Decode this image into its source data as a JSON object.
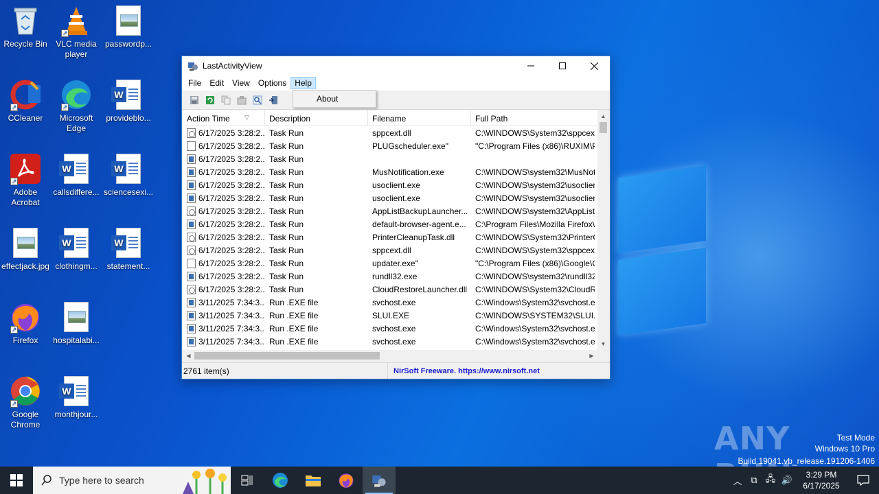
{
  "desktop": {
    "icons": [
      {
        "label": "Recycle Bin"
      },
      {
        "label": "VLC media player"
      },
      {
        "label": "passwordp..."
      },
      {
        "label": "CCleaner"
      },
      {
        "label": "Microsoft Edge"
      },
      {
        "label": "provideblo..."
      },
      {
        "label": "Adobe Acrobat"
      },
      {
        "label": "callsdiffere..."
      },
      {
        "label": "sciencesexi..."
      },
      {
        "label": "effectjack.jpg"
      },
      {
        "label": "clothingm..."
      },
      {
        "label": "statement..."
      },
      {
        "label": "Firefox"
      },
      {
        "label": "hospitalabi..."
      },
      {
        "label": "Google Chrome"
      },
      {
        "label": "monthjour..."
      }
    ]
  },
  "window": {
    "title": "LastActivityView",
    "menu": [
      "File",
      "Edit",
      "View",
      "Options",
      "Help"
    ],
    "help_dropdown": {
      "about": "About"
    },
    "columns": [
      "Action Time",
      "Description",
      "Filename",
      "Full Path"
    ],
    "rows": [
      {
        "icon": "dll",
        "time": "6/17/2025 3:28:2...",
        "desc": "Task Run",
        "file": "sppcext.dll",
        "path": "C:\\WINDOWS\\System32\\sppcext.c"
      },
      {
        "icon": "blank",
        "time": "6/17/2025 3:28:2...",
        "desc": "Task Run",
        "file": "PLUGscheduler.exe\"",
        "path": "\"C:\\Program Files (x86)\\RUXIM\\PL"
      },
      {
        "icon": "exe",
        "time": "6/17/2025 3:28:2...",
        "desc": "Task Run",
        "file": "",
        "path": ""
      },
      {
        "icon": "exe",
        "time": "6/17/2025 3:28:2...",
        "desc": "Task Run",
        "file": "MusNotification.exe",
        "path": "C:\\WINDOWS\\system32\\MusNoti"
      },
      {
        "icon": "exe",
        "time": "6/17/2025 3:28:2...",
        "desc": "Task Run",
        "file": "usoclient.exe",
        "path": "C:\\WINDOWS\\system32\\usoclient"
      },
      {
        "icon": "exe",
        "time": "6/17/2025 3:28:2...",
        "desc": "Task Run",
        "file": "usoclient.exe",
        "path": "C:\\WINDOWS\\system32\\usoclient"
      },
      {
        "icon": "dll",
        "time": "6/17/2025 3:28:2...",
        "desc": "Task Run",
        "file": "AppListBackupLauncher...",
        "path": "C:\\WINDOWS\\system32\\AppListB"
      },
      {
        "icon": "exe",
        "time": "6/17/2025 3:28:2...",
        "desc": "Task Run",
        "file": "default-browser-agent.e...",
        "path": "C:\\Program Files\\Mozilla Firefox\\c"
      },
      {
        "icon": "dll",
        "time": "6/17/2025 3:28:2...",
        "desc": "Task Run",
        "file": "PrinterCleanupTask.dll",
        "path": "C:\\WINDOWS\\System32\\PrinterCl"
      },
      {
        "icon": "dll",
        "time": "6/17/2025 3:28:2...",
        "desc": "Task Run",
        "file": "sppcext.dll",
        "path": "C:\\WINDOWS\\System32\\sppcext.c"
      },
      {
        "icon": "blank",
        "time": "6/17/2025 3:28:2...",
        "desc": "Task Run",
        "file": "updater.exe\"",
        "path": "\"C:\\Program Files (x86)\\Google\\G"
      },
      {
        "icon": "exe",
        "time": "6/17/2025 3:28:2...",
        "desc": "Task Run",
        "file": "rundll32.exe",
        "path": "C:\\WINDOWS\\system32\\rundll32."
      },
      {
        "icon": "dll",
        "time": "6/17/2025 3:28:2...",
        "desc": "Task Run",
        "file": "CloudRestoreLauncher.dll",
        "path": "C:\\WINDOWS\\System32\\CloudRe"
      },
      {
        "icon": "exe",
        "time": "3/11/2025 7:34:3...",
        "desc": "Run .EXE file",
        "file": "svchost.exe",
        "path": "C:\\Windows\\System32\\svchost.ex"
      },
      {
        "icon": "exe",
        "time": "3/11/2025 7:34:3...",
        "desc": "Run .EXE file",
        "file": "SLUI.EXE",
        "path": "C:\\WINDOWS\\SYSTEM32\\SLUI.EXE"
      },
      {
        "icon": "exe",
        "time": "3/11/2025 7:34:3...",
        "desc": "Run .EXE file",
        "file": "svchost.exe",
        "path": "C:\\Windows\\System32\\svchost.ex"
      },
      {
        "icon": "exe",
        "time": "3/11/2025 7:34:3...",
        "desc": "Run .EXE file",
        "file": "svchost.exe",
        "path": "C:\\Windows\\System32\\svchost.ex"
      }
    ],
    "status": {
      "count": "2761 item(s)",
      "link": "NirSoft Freeware. https://www.nirsoft.net"
    }
  },
  "watermark": {
    "brand": "ANY RUN",
    "mode": "Test Mode",
    "edition": "Windows 10 Pro",
    "build": "Build 19041.vb_release.191206-1406"
  },
  "taskbar": {
    "search_placeholder": "Type here to search",
    "time": "3:29 PM",
    "date": "6/17/2025"
  }
}
